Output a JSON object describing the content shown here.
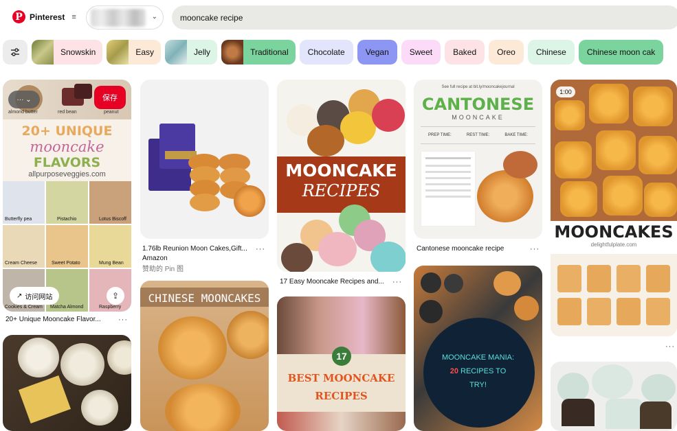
{
  "header": {
    "logo_letter": "P",
    "brand": "Pinterest",
    "menu_icon": "≡",
    "board_chevron": "⌄",
    "search_value": "mooncake recipe"
  },
  "chips": [
    {
      "label": "Snowskin",
      "bg": "#fde3e6",
      "thumb": "#9a9a5a"
    },
    {
      "label": "Easy",
      "bg": "#fde9d8",
      "thumb": "#c9b05a"
    },
    {
      "label": "Jelly",
      "bg": "#dcf5e7",
      "thumb": "#9fc4c4"
    },
    {
      "label": "Traditional",
      "bg": "#7bd49d",
      "thumb": "#a0643b"
    },
    {
      "label": "Chocolate",
      "bg": "#e2e5fb"
    },
    {
      "label": "Vegan",
      "bg": "#8d97f3"
    },
    {
      "label": "Sweet",
      "bg": "#fbdbf7"
    },
    {
      "label": "Baked",
      "bg": "#fde3e6"
    },
    {
      "label": "Oreo",
      "bg": "#fde9d8"
    },
    {
      "label": "Chinese",
      "bg": "#dcf5e7"
    },
    {
      "label": "Chinese moon cak",
      "bg": "#7bd49d"
    }
  ],
  "pins": {
    "p1": {
      "dots": "··· ⌄",
      "save": "保存",
      "labels_top": [
        "almond butter",
        "red bean",
        "peanut"
      ],
      "heading": [
        "20+ UNIQUE",
        "mooncake",
        "FLAVORS"
      ],
      "site": "allpurposeveggies.com",
      "grid_labels": [
        "Butterfly pea",
        "Pistachio",
        "Lotus Biscoff",
        "Cream Cheese",
        "Sweet Potato",
        "Mung Bean",
        "Cookies & Cream",
        "Matcha Almond",
        "Raspberry"
      ],
      "visit": "访问网站",
      "title": "20+ Unique Mooncake Flavor..."
    },
    "p2": {
      "title": "1.76lb Reunion Moon Cakes,Gift...",
      "source": "Amazon",
      "sponsor": "赞助的 Pin 图"
    },
    "p3": {
      "banner1": "MOONCAKE",
      "banner2": "RECIPES",
      "title": "17 Easy Mooncake Recipes and..."
    },
    "p4": {
      "top_line": "See full recipe at bit.ly/mooncakejournal",
      "heading": "CANTONESE",
      "sub": "MOONCAKE",
      "times": [
        "PREP TIME:",
        "REST TIME:",
        "BAKE TIME:"
      ],
      "title": "Cantonese mooncake recipe"
    },
    "p5": {
      "duration": "1:00",
      "banner": "MOONCAKES",
      "site": "delightfulplate.com"
    },
    "p6": {
      "heading": "CHINESE MOONCAKES"
    },
    "p7": {
      "badge": "17",
      "line1": "BEST MOONCAKE",
      "line2": "RECIPES"
    },
    "p8": {
      "line1": "MOONCAKE MANIA:",
      "num": "20",
      "line2": "RECIPES TO",
      "line3": "TRY!"
    }
  },
  "more": "···",
  "share_icon": "⇪",
  "colors": {
    "brand": "#e60023"
  }
}
